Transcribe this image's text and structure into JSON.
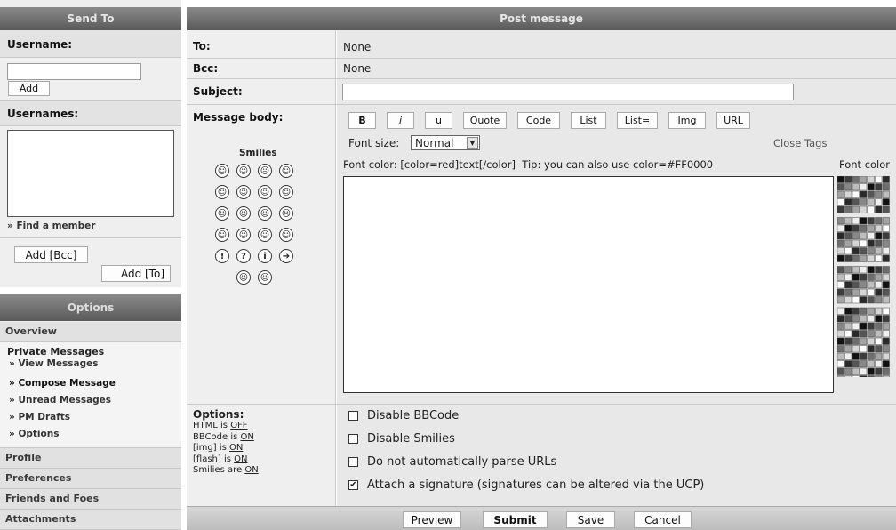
{
  "send_to": {
    "header": "Send To",
    "username_label": "Username:",
    "username_value": "",
    "add_label": "Add",
    "usernames_label": "Usernames:",
    "find_member": "» Find a member",
    "add_bcc_label": "Add [Bcc]",
    "add_to_label": "Add [To]"
  },
  "options_menu": {
    "header": "Options",
    "overview": "Overview",
    "private_messages": "Private Messages",
    "items": [
      "» View Messages",
      "» Compose Message",
      "» Unread Messages",
      "» PM Drafts",
      "» Options"
    ],
    "profile": "Profile",
    "preferences": "Preferences",
    "friends": "Friends and Foes",
    "attachments": "Attachments"
  },
  "post": {
    "header": "Post message",
    "to_label": "To:",
    "to_value": "None",
    "bcc_label": "Bcc:",
    "bcc_value": "None",
    "subject_label": "Subject:",
    "subject_value": "",
    "body_label": "Message body:",
    "smilies_label": "Smilies",
    "smilies": [
      "☺",
      "☺",
      "☹",
      "☺",
      "☺",
      "☺",
      "☺",
      "☺",
      "☺",
      "☺",
      "☺",
      "☹",
      "☺",
      "☺",
      "☺",
      "☺",
      "!",
      "?",
      "i",
      "➔",
      "☺",
      "☺"
    ],
    "bbcode_buttons": [
      "B",
      "i",
      "u",
      "Quote",
      "Code",
      "List",
      "List=",
      "Img",
      "URL"
    ],
    "font_size_label": "Font size:",
    "font_size_value": "Normal",
    "close_tags": "Close Tags",
    "font_color_tip": "Font color: [color=red]text[/color]  Tip: you can also use color=#FF0000",
    "font_color_label": "Font color",
    "message_value": ""
  },
  "options_panel": {
    "title": "Options:",
    "html_prefix": "HTML is ",
    "html_value": "OFF",
    "bbcode_prefix": "BBCode is ",
    "bbcode_value": "ON",
    "img_prefix": "[img] is ",
    "img_value": "ON",
    "flash_prefix": "[flash] is ",
    "flash_value": "ON",
    "smilies_prefix": "Smilies are ",
    "smilies_value": "ON",
    "checkboxes": [
      {
        "label": "Disable BBCode",
        "checked": false
      },
      {
        "label": "Disable Smilies",
        "checked": false
      },
      {
        "label": "Do not automatically parse URLs",
        "checked": false
      },
      {
        "label": "Attach a signature (signatures can be altered via the UCP)",
        "checked": true
      }
    ]
  },
  "actions": {
    "preview": "Preview",
    "submit": "Submit",
    "save": "Save",
    "cancel": "Cancel"
  }
}
